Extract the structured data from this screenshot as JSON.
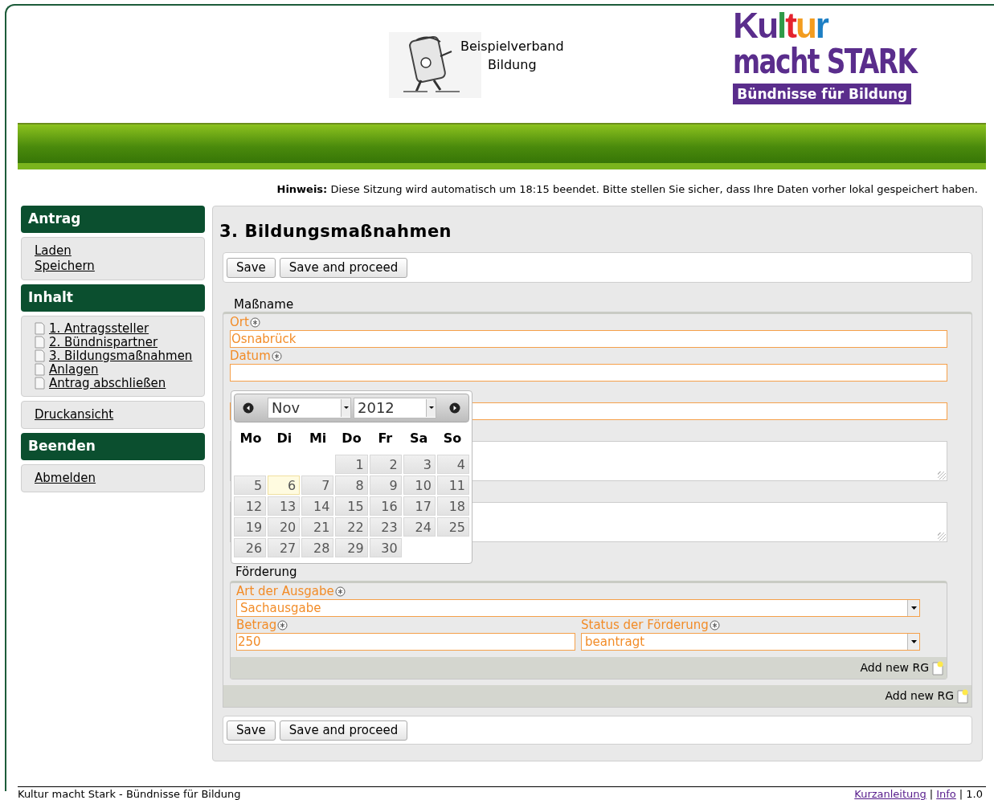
{
  "header": {
    "org_name": [
      "Beispielverband",
      "Bildung"
    ],
    "logo": {
      "line1": [
        {
          "char": "K",
          "color": "#5a2d8c"
        },
        {
          "char": "u",
          "color": "#5a2d8c"
        },
        {
          "char": "l",
          "color": "#2f9a48"
        },
        {
          "char": "t",
          "color": "#e4232e"
        },
        {
          "char": "u",
          "color": "#f39c1f"
        },
        {
          "char": "r",
          "color": "#1d7fc4"
        }
      ],
      "line2": "macht STARK",
      "tagline": "Bündnisse für Bildung"
    }
  },
  "notice": {
    "label": "Hinweis:",
    "text": "Diese Sitzung wird automatisch um 18:15 beendet. Bitte stellen Sie sicher, dass Ihre Daten vorher lokal gespeichert haben."
  },
  "sidebar": [
    {
      "title": "Antrag",
      "items": [
        {
          "label": "Laden",
          "kind": "link"
        },
        {
          "label": "Speichern",
          "kind": "link"
        }
      ]
    },
    {
      "title": "Inhalt",
      "items": [
        {
          "label": "1. Antragssteller",
          "kind": "page"
        },
        {
          "label": "2. Bündnispartner",
          "kind": "page"
        },
        {
          "label": "3. Bildungsmaßnahmen",
          "kind": "page"
        },
        {
          "label": "Anlagen",
          "kind": "page"
        },
        {
          "label": "Antrag abschließen",
          "kind": "page"
        }
      ]
    },
    {
      "items": [
        {
          "label": "Druckansicht",
          "kind": "link"
        }
      ]
    },
    {
      "title": "Beenden",
      "items": [
        {
          "label": "Abmelden",
          "kind": "link"
        }
      ]
    }
  ],
  "page_title": "3. Bildungsmaßnahmen",
  "top_buttons": [
    "Save",
    "Save and proceed"
  ],
  "section": {
    "legend": "Maßname",
    "fields": [
      {
        "kind": "input",
        "label": "Ort",
        "required": true,
        "value": "Osnabrück"
      },
      {
        "kind": "input",
        "label": "Datum",
        "required": true
      },
      {
        "kind": "input"
      },
      {
        "kind": "textarea"
      },
      {
        "kind": "textarea"
      }
    ],
    "subsection": {
      "legend": "Förderung",
      "rows": [
        [
          {
            "kind": "select",
            "label": "Art der Ausgabe",
            "required": true,
            "value": "Sachausgabe"
          }
        ],
        [
          {
            "kind": "input",
            "label": "Betrag",
            "required": true,
            "value": "250"
          },
          {
            "kind": "select",
            "label": "Status der Förderung",
            "required": true,
            "value": "beantragt"
          }
        ]
      ],
      "add_label": "Add new RG"
    },
    "add_label": "Add new RG"
  },
  "bottom_buttons": [
    "Save",
    "Save and proceed"
  ],
  "datepicker": {
    "month": "Nov",
    "year": "2012",
    "weekdays": [
      "Mo",
      "Di",
      "Mi",
      "Do",
      "Fr",
      "Sa",
      "So"
    ],
    "weeks": [
      [
        {
          "kind": "empty"
        },
        {
          "kind": "empty"
        },
        {
          "kind": "empty"
        },
        {
          "day": "1",
          "today": false
        },
        {
          "day": "2",
          "today": false
        },
        {
          "day": "3",
          "today": false
        },
        {
          "day": "4",
          "today": false
        }
      ],
      [
        {
          "day": "5",
          "today": false
        },
        {
          "day": "6",
          "today": true
        },
        {
          "day": "7",
          "today": false
        },
        {
          "day": "8",
          "today": false
        },
        {
          "day": "9",
          "today": false
        },
        {
          "day": "10",
          "today": false
        },
        {
          "day": "11",
          "today": false
        }
      ],
      [
        {
          "day": "12",
          "today": false
        },
        {
          "day": "13",
          "today": false
        },
        {
          "day": "14",
          "today": false
        },
        {
          "day": "15",
          "today": false
        },
        {
          "day": "16",
          "today": false
        },
        {
          "day": "17",
          "today": false
        },
        {
          "day": "18",
          "today": false
        }
      ],
      [
        {
          "day": "19",
          "today": false
        },
        {
          "day": "20",
          "today": false
        },
        {
          "day": "21",
          "today": false
        },
        {
          "day": "22",
          "today": false
        },
        {
          "day": "23",
          "today": false
        },
        {
          "day": "24",
          "today": false
        },
        {
          "day": "25",
          "today": false
        }
      ],
      [
        {
          "day": "26",
          "today": false
        },
        {
          "day": "27",
          "today": false
        },
        {
          "day": "28",
          "today": false
        },
        {
          "day": "29",
          "today": false
        },
        {
          "day": "30",
          "today": false
        },
        {
          "kind": "empty"
        },
        {
          "kind": "empty"
        }
      ]
    ]
  },
  "footer": {
    "left": "Kultur macht Stark - Bündnisse für Bildung",
    "right": [
      {
        "kind": "link",
        "text": "Kurzanleitung"
      },
      {
        "kind": "text",
        "text": "|"
      },
      {
        "kind": "link",
        "text": "Info"
      },
      {
        "kind": "text",
        "text": "| 1.0"
      }
    ]
  }
}
